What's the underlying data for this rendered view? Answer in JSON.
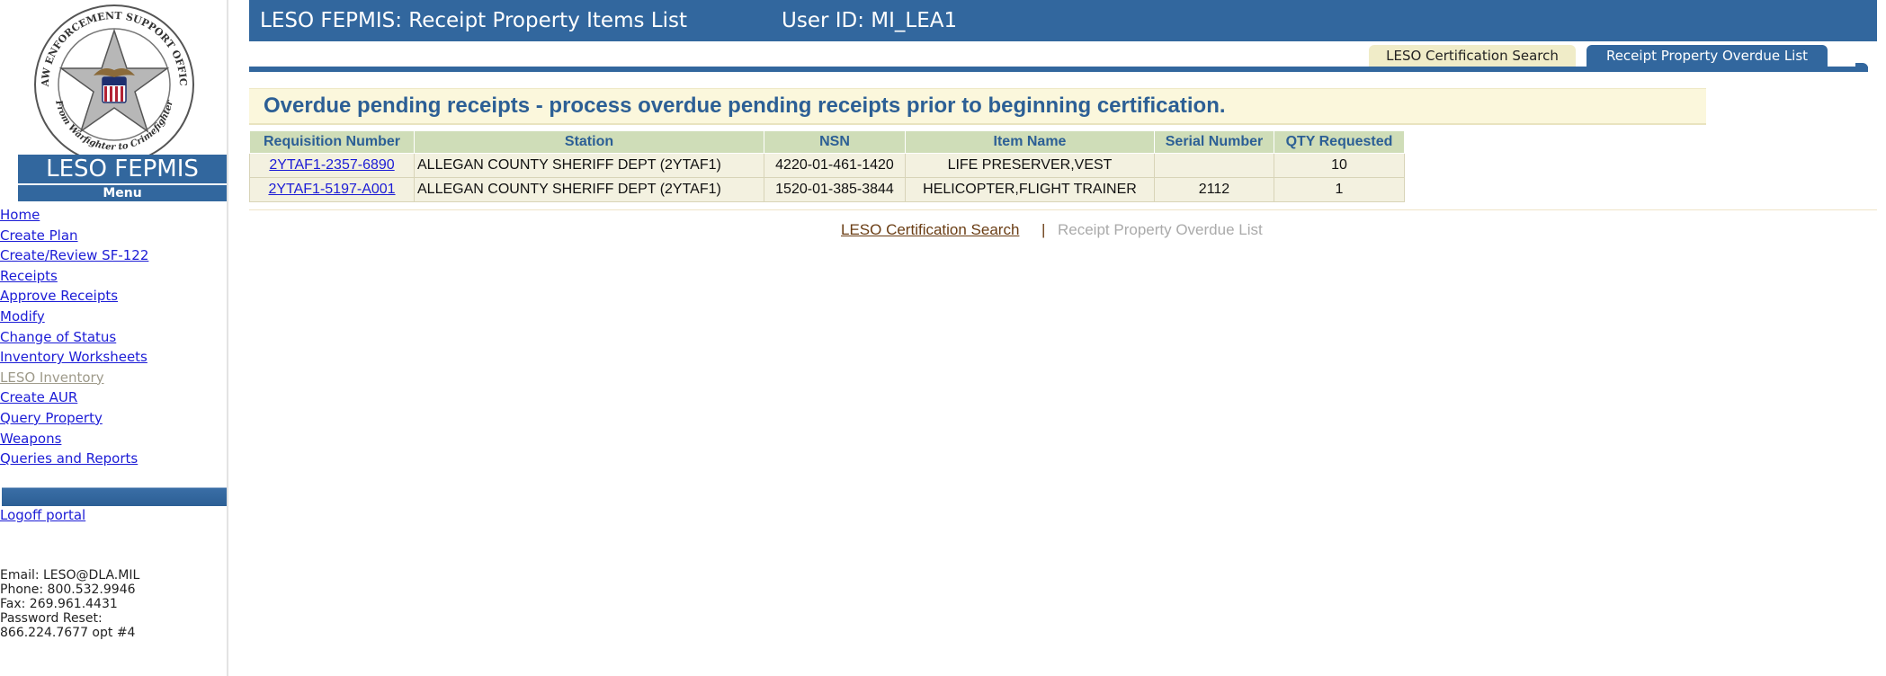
{
  "sidebar": {
    "logo": {
      "seal_text_top": "LAW ENFORCEMENT SUPPORT OFFICE",
      "seal_text_bottom": "From Warfighter to Crimefighter"
    },
    "brand": "LESO FEPMIS",
    "menu_header": "Menu",
    "menu_items": [
      {
        "label": "Home",
        "enabled": true
      },
      {
        "label": "Create Plan",
        "enabled": true
      },
      {
        "label": "Create/Review SF-122",
        "enabled": true
      },
      {
        "label": "Receipts",
        "enabled": true
      },
      {
        "label": "Approve Receipts",
        "enabled": true
      },
      {
        "label": "Modify",
        "enabled": true
      },
      {
        "label": "Change of Status",
        "enabled": true
      },
      {
        "label": "Inventory Worksheets",
        "enabled": true
      },
      {
        "label": "LESO Inventory",
        "enabled": false
      },
      {
        "label": "Create AUR",
        "enabled": true
      },
      {
        "label": "Query Property",
        "enabled": true
      },
      {
        "label": "Weapons",
        "enabled": true
      },
      {
        "label": "Queries and Reports",
        "enabled": true
      }
    ],
    "logoff": "Logoff portal",
    "contact": {
      "email": "Email: LESO@DLA.MIL",
      "phone": "Phone: 800.532.9946",
      "fax": "Fax: 269.961.4431",
      "password_reset": "Password Reset:",
      "password_reset_number": "866.224.7677 opt #4"
    }
  },
  "header": {
    "title": "LESO FEPMIS: Receipt Property Items List",
    "user_id": "User ID: MI_LEA1",
    "tabs": [
      {
        "label": "LESO Certification Search",
        "active": false
      },
      {
        "label": "Receipt Property Overdue List",
        "active": true
      }
    ]
  },
  "main": {
    "banner": "Overdue pending receipts - process overdue pending receipts prior to beginning certification.",
    "table": {
      "columns": [
        "Requisition Number",
        "Station",
        "NSN",
        "Item Name",
        "Serial Number",
        "QTY Requested"
      ],
      "rows": [
        [
          "2YTAF1-2357-6890",
          "ALLEGAN COUNTY SHERIFF DEPT (2YTAF1)",
          "4220-01-461-1420",
          "LIFE PRESERVER,VEST",
          "",
          "10"
        ],
        [
          "2YTAF1-5197-A001",
          "ALLEGAN COUNTY SHERIFF DEPT (2YTAF1)",
          "1520-01-385-3844",
          "HELICOPTER,FLIGHT TRAINER",
          "2112",
          "1"
        ]
      ]
    },
    "bottom_links": {
      "search": "LESO Certification Search",
      "separator": "|",
      "current": "Receipt Property Overdue List"
    }
  },
  "colors": {
    "primary": "#32679e",
    "link": "#1c1cd6",
    "header_cell": "#cfddb8",
    "banner_bg": "#fbf7dc"
  }
}
